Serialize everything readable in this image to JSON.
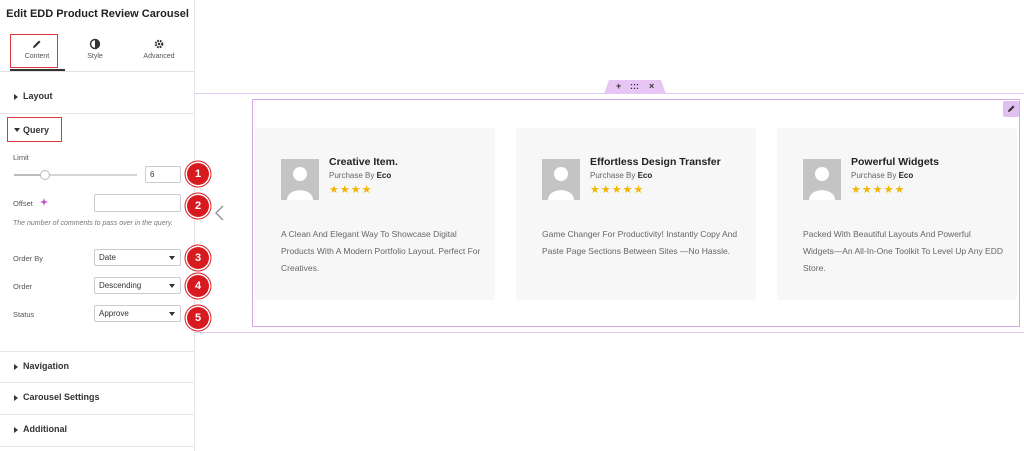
{
  "panel": {
    "title": "Edit EDD Product Review Carousel",
    "tabs": [
      {
        "label": "Content",
        "icon": "pencil-icon"
      },
      {
        "label": "Style",
        "icon": "half-circle-icon"
      },
      {
        "label": "Advanced",
        "icon": "gear-icon"
      }
    ],
    "sections": {
      "layout": "Layout",
      "query": "Query",
      "navigation": "Navigation",
      "carousel_settings": "Carousel Settings",
      "additional": "Additional"
    },
    "query": {
      "limit_label": "Limit",
      "limit_value": "6",
      "limit_slider_fraction": 0.25,
      "offset_label": "Offset",
      "offset_value": "",
      "offset_help": "The number of comments to pass over in the query.",
      "order_by_label": "Order By",
      "order_by_value": "Date",
      "order_label": "Order",
      "order_value": "Descending",
      "status_label": "Status",
      "status_value": "Approve"
    },
    "badges": [
      "1",
      "2",
      "3",
      "4",
      "5"
    ],
    "colors": {
      "highlight": "#d9363e",
      "badge": "#d71920",
      "accent": "#d9a6ec"
    }
  },
  "canvas": {
    "cards": [
      {
        "title": "Creative Item.",
        "purchase_prefix": "Purchase By",
        "purchase_by": "Eco",
        "stars": "★★★★",
        "description": "A Clean And Elegant Way To Showcase Digital Products With A Modern Portfolio Layout. Perfect For Creatives."
      },
      {
        "title": "Effortless Design Transfer",
        "purchase_prefix": "Purchase By",
        "purchase_by": "Eco",
        "stars": "★★★★★",
        "description": "Game Changer For Productivity! Instantly Copy And Paste Page Sections Between Sites —No Hassle."
      },
      {
        "title": "Powerful Widgets",
        "purchase_prefix": "Purchase By",
        "purchase_by": "Eco",
        "stars": "★★★★★",
        "description": "Packed With Beautiful Layouts And Powerful Widgets—An All-In-One Toolkit To Level Up Any EDD Store."
      }
    ],
    "handle_icons": [
      "+",
      ":::",
      "×"
    ]
  }
}
